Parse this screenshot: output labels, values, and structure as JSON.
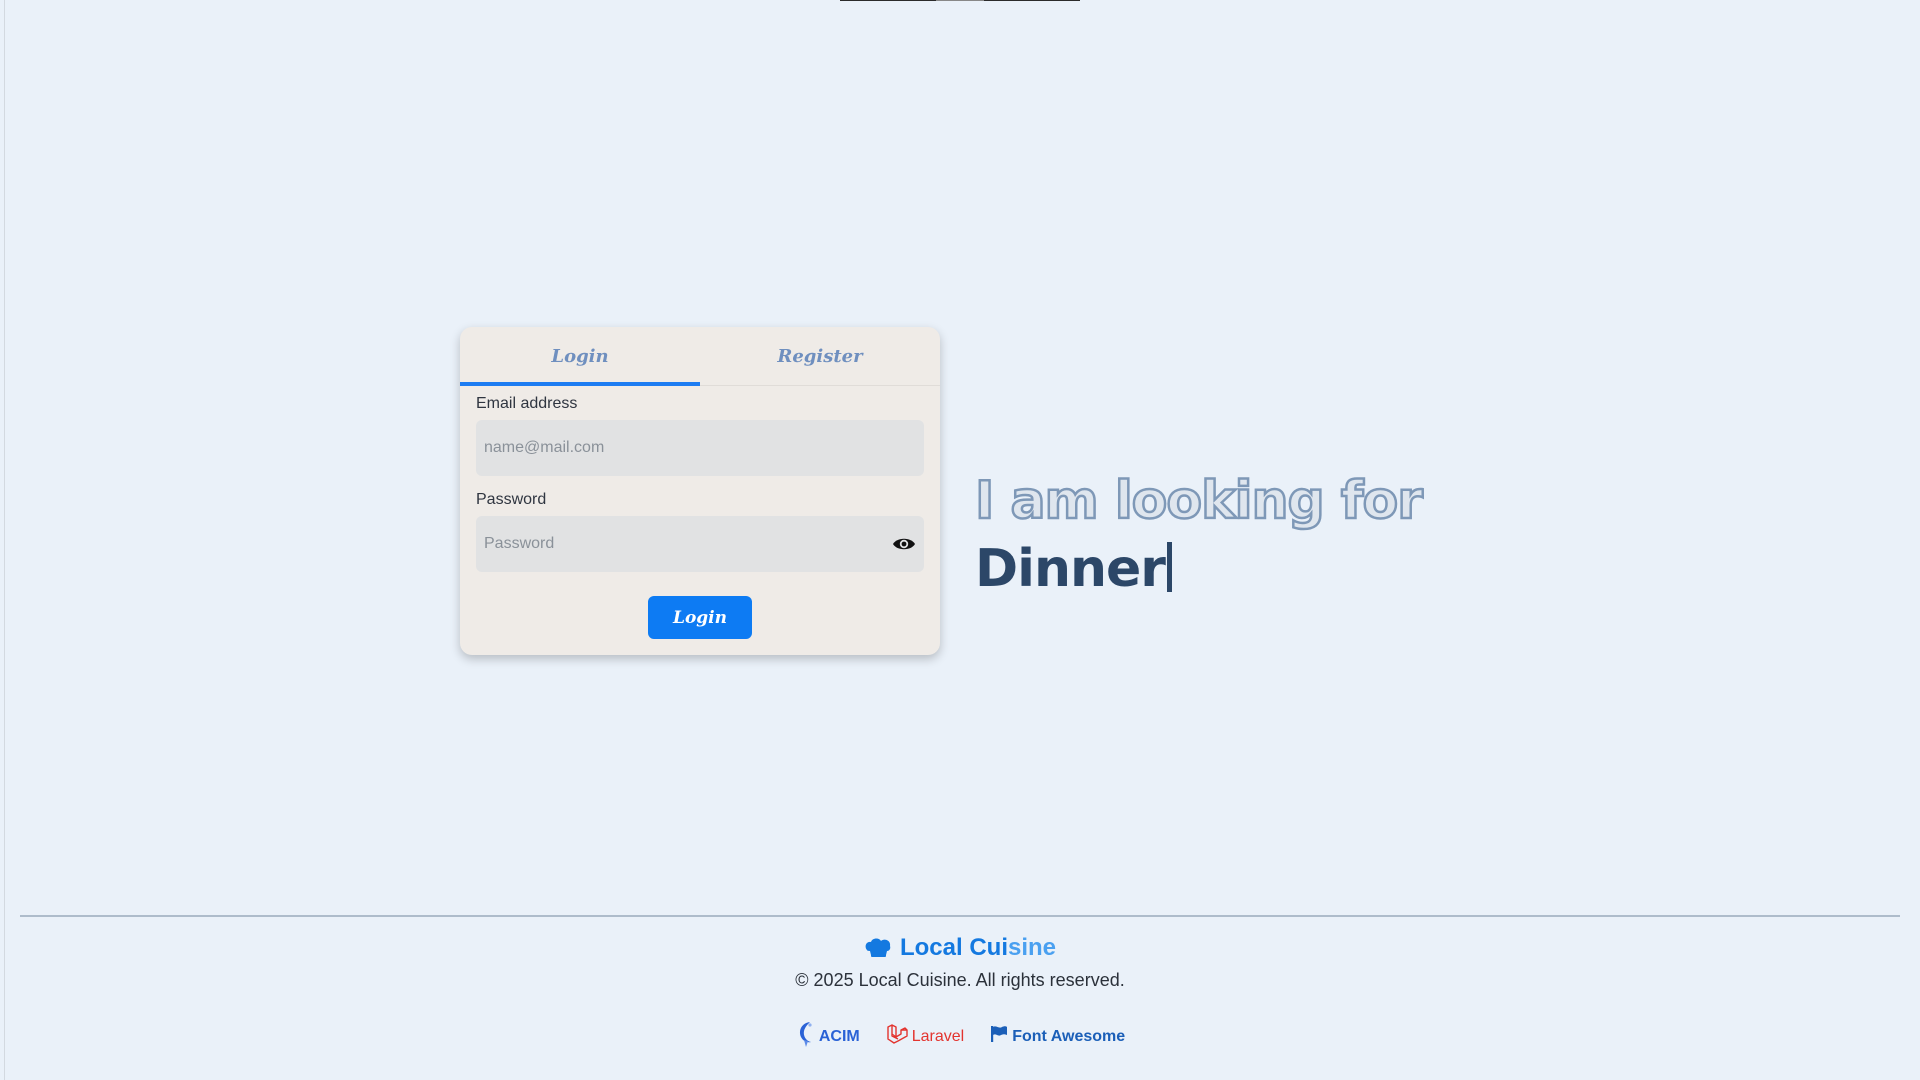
{
  "auth_card": {
    "tabs": [
      {
        "label": "Login",
        "active": true
      },
      {
        "label": "Register",
        "active": false
      }
    ],
    "email": {
      "label": "Email address",
      "placeholder": "name@mail.com",
      "value": ""
    },
    "password": {
      "label": "Password",
      "placeholder": "Password",
      "value": ""
    },
    "submit_label": "Login"
  },
  "hero": {
    "line1": "I am looking for",
    "line2": "Dinner"
  },
  "footer": {
    "brand_part1": "Local Cui",
    "brand_part2": "sine",
    "copyright": "© 2025 Local Cuisine. All rights reserved.",
    "credits": [
      {
        "label": "ACIM",
        "icon": "acim-logo-icon"
      },
      {
        "label": "Laravel",
        "icon": "laravel-logo-icon"
      },
      {
        "label": "Font Awesome",
        "icon": "flag-icon"
      }
    ]
  },
  "colors": {
    "page_background": "#eaf1f9",
    "card_background": "#efebe7",
    "primary": "#0d7bf3",
    "tab_text": "#6f8fbf",
    "hero_dark": "#2c4768",
    "brand": "#1479e0"
  }
}
